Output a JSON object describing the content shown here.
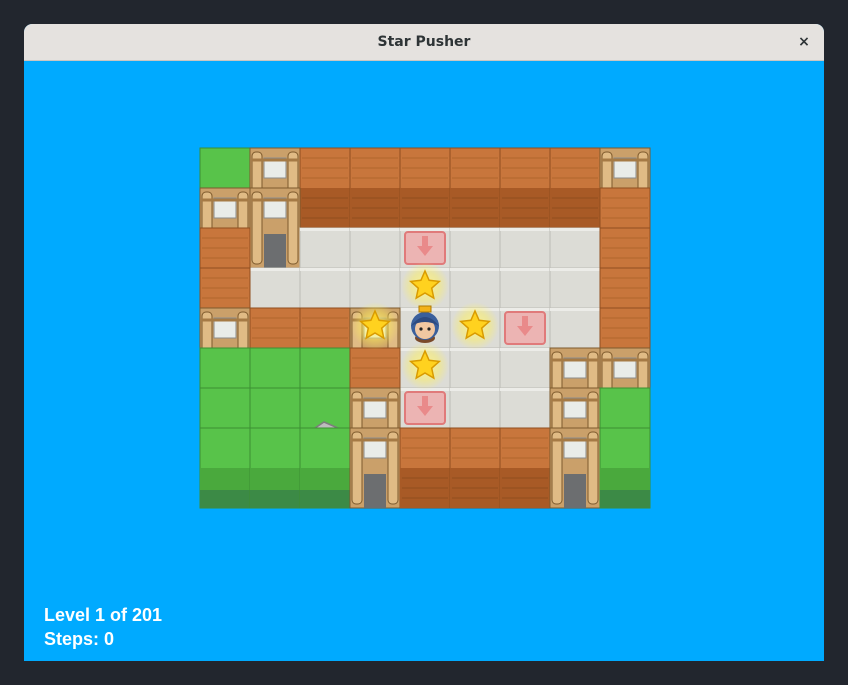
{
  "window": {
    "title": "Star Pusher",
    "close_glyph": "×"
  },
  "status": {
    "level_text": "Level 1 of 201",
    "steps_text": "Steps: 0"
  },
  "colors": {
    "background": "#00aaff",
    "wood": "#c8763c",
    "floor": "#dcdcd6",
    "grass": "#58c34a",
    "goal": "#f2a7a7",
    "star": "#ffd21f"
  },
  "level": {
    "legend": {
      "W": "wood-wall",
      "P": "pillar-wall",
      "F": "floor",
      "G": "grass",
      "R": "grass-rock",
      "g": "goal-floor",
      "s": "star-floor",
      "@": "player-floor"
    },
    "rows": [
      "GPWWWWWWP",
      "PPFFgFFFW",
      "WFFFsFFFW",
      "WFgs@sgFW",
      "PWWPsFFFW",
      "GGGWgFFPP",
      "GGRPFFFPG",
      "GGGPWWWPG"
    ]
  }
}
